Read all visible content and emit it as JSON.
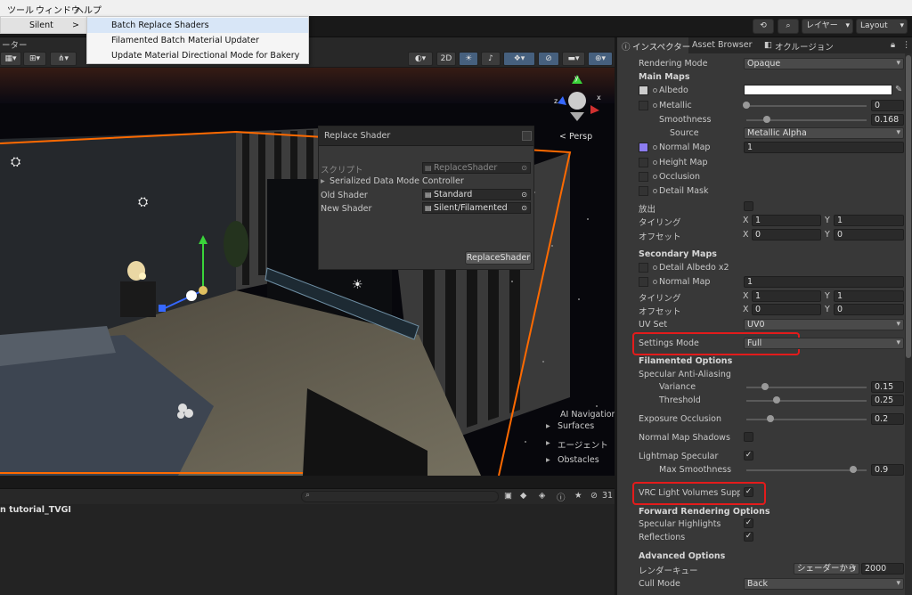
{
  "menubar": {
    "items": [
      "ツール",
      "ウィンドウ",
      "ヘルプ"
    ]
  },
  "menu": {
    "parent_item": "Silent",
    "submenu_arrow": ">",
    "items": [
      "Batch Replace Shaders",
      "Filamented Batch Material Updater",
      "Update Material Directional Mode for Bakery"
    ]
  },
  "toolbar": {
    "layers_label": "レイヤー",
    "layout_label": "Layout"
  },
  "scene": {
    "tab_label": "ーター",
    "mode_2d": "2D",
    "persp_label": "< Persp",
    "ai_nav_title": "AI Navigation",
    "ai_nav_items": [
      "Surfaces",
      "エージェント",
      "Obstacles"
    ]
  },
  "replace_shader": {
    "title": "Replace Shader",
    "script_label": "スクリプト",
    "script_value": "ReplaceShader",
    "foldout": "Serialized Data Mode Controller",
    "old_label": "Old Shader",
    "old_value": "Standard",
    "new_label": "New Shader",
    "new_value": "Silent/Filamented",
    "button": "ReplaceShader"
  },
  "bottom": {
    "item": "n tutorial_TVGI",
    "badge_count": "31"
  },
  "inspector": {
    "tabs": [
      "インスペクター",
      "Asset Browser",
      "オクルージョン"
    ],
    "rendering_mode_label": "Rendering Mode",
    "rendering_mode_value": "Opaque",
    "main_maps": "Main Maps",
    "albedo": "Albedo",
    "metallic": "Metallic",
    "metallic_value": "0",
    "smoothness": "Smoothness",
    "smoothness_value": "0.168",
    "source": "Source",
    "source_value": "Metallic Alpha",
    "normal_map": "Normal Map",
    "normal_map_value": "1",
    "height_map": "Height Map",
    "occlusion": "Occlusion",
    "detail_mask": "Detail Mask",
    "emission": "放出",
    "tiling": "タイリング",
    "offset": "オフセット",
    "x": "X",
    "y": "Y",
    "tiling_x": "1",
    "tiling_y": "1",
    "offset_x": "0",
    "offset_y": "0",
    "secondary_maps": "Secondary Maps",
    "detail_albedo": "Detail Albedo x2",
    "normal_map2": "Normal Map",
    "normal_map2_value": "1",
    "tiling2_x": "1",
    "tiling2_y": "1",
    "offset2_x": "0",
    "offset2_y": "0",
    "uv_set": "UV Set",
    "uv_set_value": "UV0",
    "settings_mode": "Settings Mode",
    "settings_mode_value": "Full",
    "filamented_options": "Filamented Options",
    "specular_aa": "Specular Anti-Aliasing",
    "variance": "Variance",
    "variance_value": "0.15",
    "threshold": "Threshold",
    "threshold_value": "0.25",
    "exposure_occlusion": "Exposure Occlusion",
    "exposure_occlusion_value": "0.2",
    "normal_map_shadows": "Normal Map Shadows",
    "lightmap_specular": "Lightmap Specular",
    "max_smoothness": "Max Smoothness",
    "max_smoothness_value": "0.9",
    "vrc_light_volumes": "VRC Light Volumes Suppor",
    "forward_options": "Forward Rendering Options",
    "specular_highlights": "Specular Highlights",
    "reflections": "Reflections",
    "advanced_options": "Advanced Options",
    "render_queue": "レンダーキュー",
    "render_queue_mode": "シェーダーから",
    "render_queue_value": "2000",
    "cull_mode": "Cull Mode",
    "cull_mode_value": "Back"
  },
  "colors": {
    "accent_orange": "#ff6a00",
    "highlight_red": "#e31b1b",
    "normal_swatch": "#8c7cf0",
    "menu_hover": "#d8e6f7"
  }
}
